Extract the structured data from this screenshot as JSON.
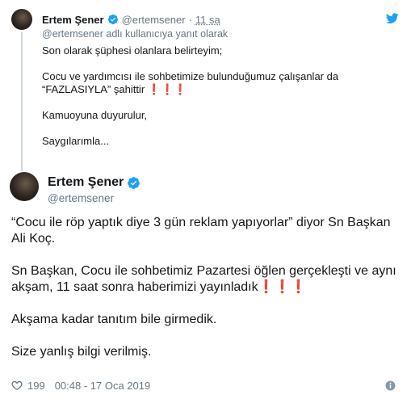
{
  "reply_tweet": {
    "author_name": "Ertem Şener",
    "author_handle": "@ertemsener",
    "separator": "·",
    "time": "11 sa",
    "replying_to": "@ertemsener adlı kullanıcıya yanıt olarak",
    "lines": [
      "Son olarak şüphesi olanlara belirteyim;",
      "",
      "Cocu ve yardımcısı ile sohbetimize bulunduğumuz çalışanlar da",
      "“FAZLASIYLA” şahittir ❗❗❗",
      "",
      "Kamuoyuna duyurulur,",
      "",
      "Saygılarımla..."
    ]
  },
  "main_tweet": {
    "author_name": "Ertem Şener",
    "author_handle": "@ertemsener",
    "lines": [
      "“Cocu ile röp yaptık diye 3 gün reklam yapıyorlar” diyor Sn Başkan",
      "Ali Koç.",
      "",
      "Sn Başkan, Cocu ile sohbetimiz Pazartesi öğlen gerçekleşti ve aynı",
      "akşam, 11 saat sonra haberimizi yayınladık❗❗❗",
      "",
      "Akşama kadar tanıtım bile girmedik.",
      "",
      "Size yanlış bilgi verilmiş."
    ],
    "likes": "199",
    "timestamp": "00:48 - 17 Oca 2019"
  },
  "icons": {
    "verified": "verified-badge-icon",
    "bird": "twitter-bird-icon",
    "heart": "heart-icon",
    "info": "info-icon"
  },
  "colors": {
    "twitter_blue": "#1da1f2",
    "secondary_text": "#657786",
    "thread_line": "#ccd6dd"
  }
}
